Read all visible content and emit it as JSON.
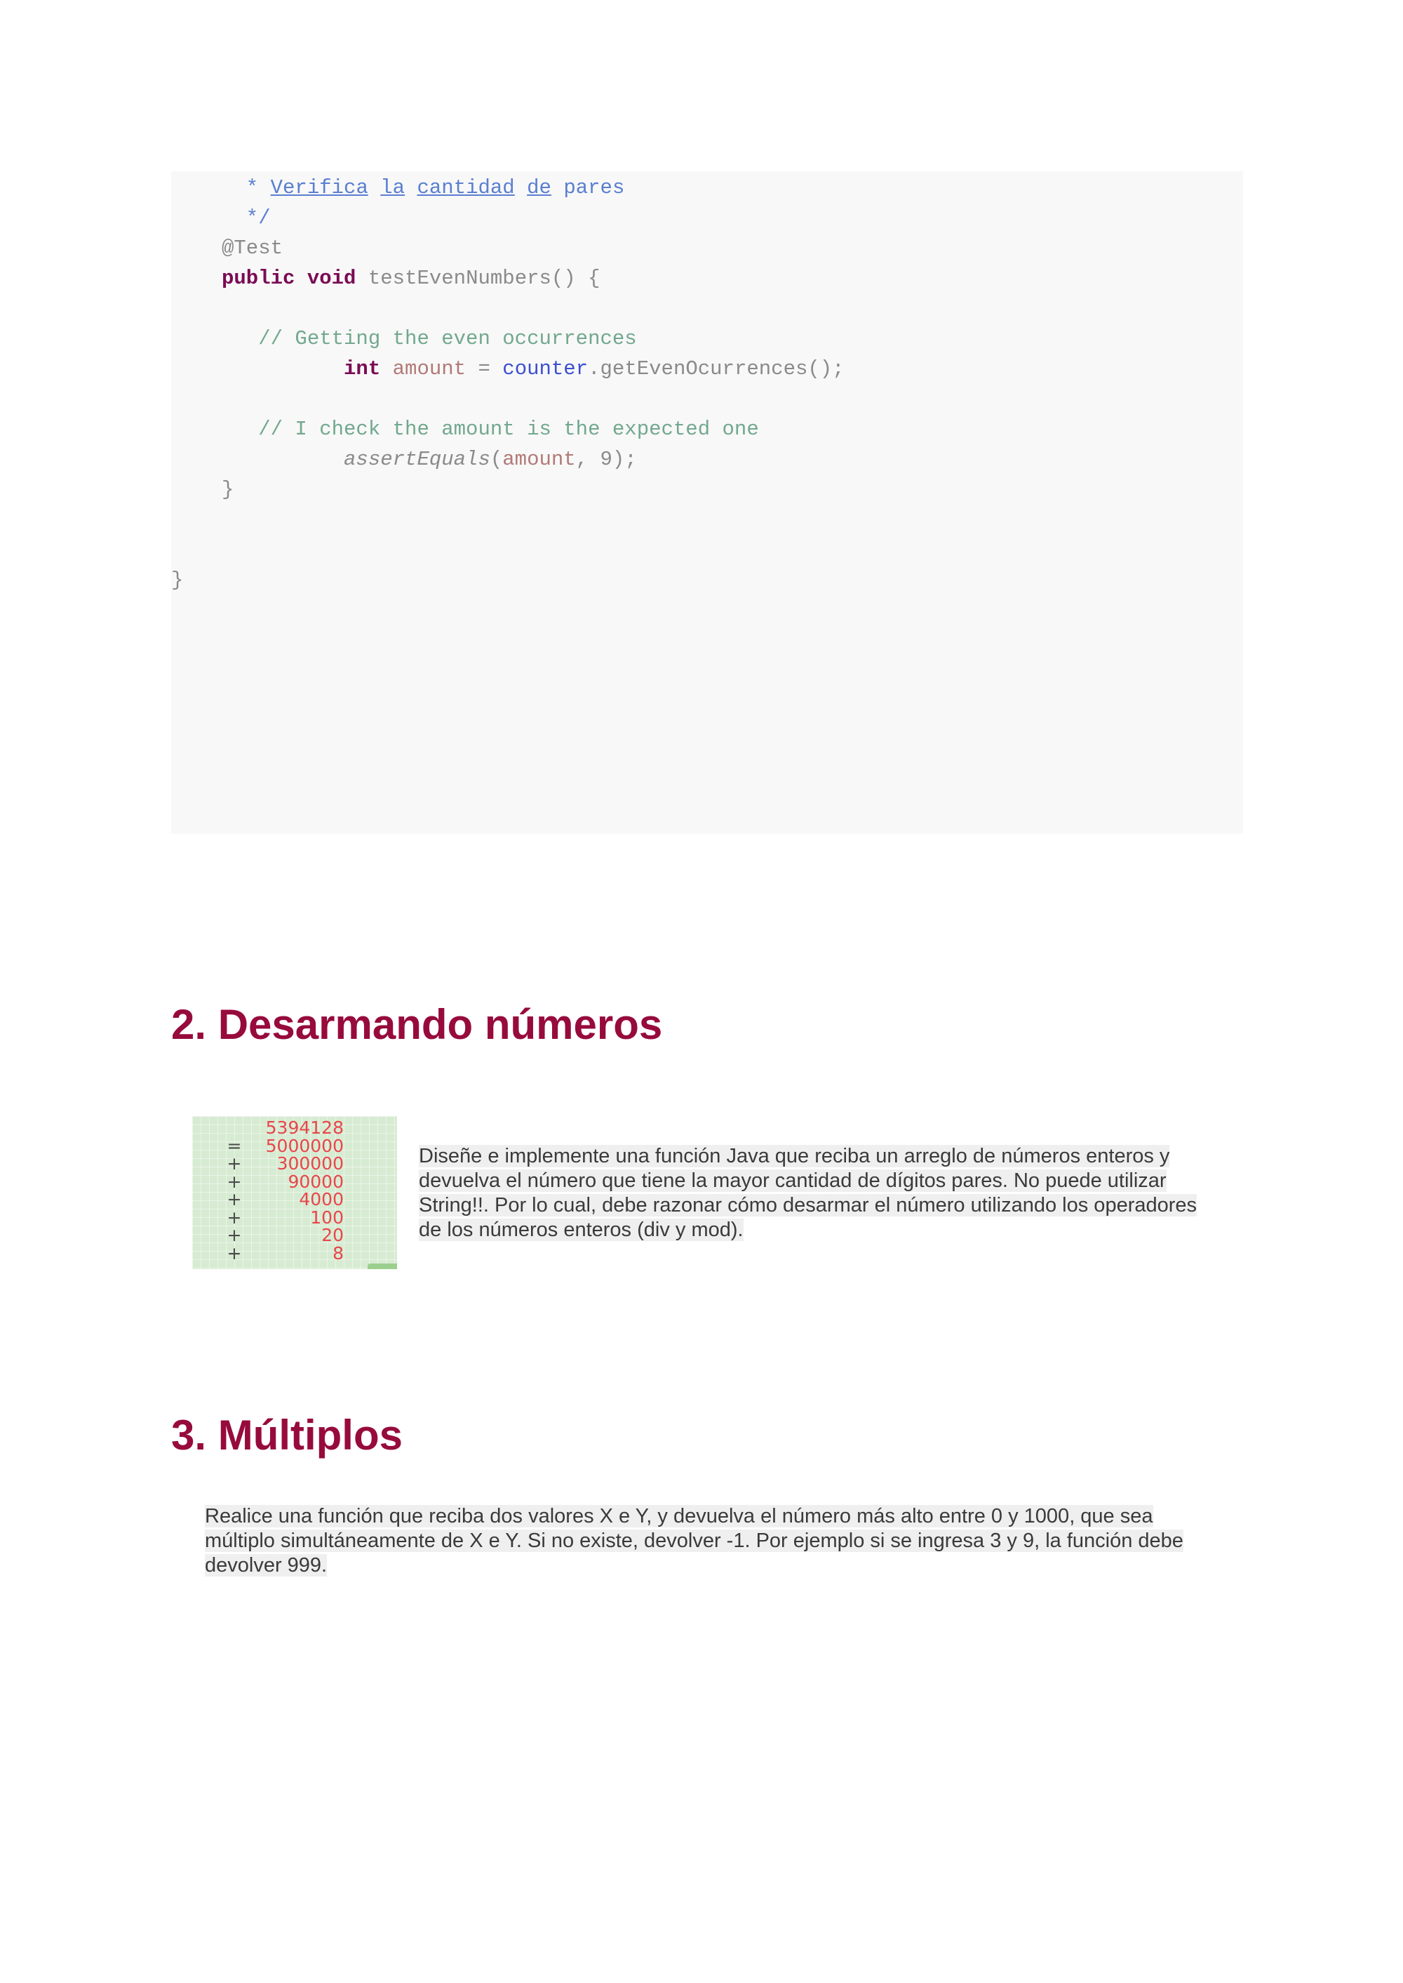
{
  "code": {
    "lines": [
      [
        {
          "t": "  * ",
          "c": "c-doc"
        },
        {
          "t": "Verifica",
          "c": "c-doc-u"
        },
        {
          "t": " ",
          "c": "c-doc"
        },
        {
          "t": "la",
          "c": "c-doc-u"
        },
        {
          "t": " ",
          "c": "c-doc"
        },
        {
          "t": "cantidad",
          "c": "c-doc-u"
        },
        {
          "t": " ",
          "c": "c-doc"
        },
        {
          "t": "de",
          "c": "c-doc-u"
        },
        {
          "t": " pares",
          "c": "c-doc"
        }
      ],
      [
        {
          "t": "  */",
          "c": "c-doc"
        }
      ],
      [
        {
          "t": "@Test",
          "c": "c-plain"
        }
      ],
      [
        {
          "t": "public",
          "c": "c-kw"
        },
        {
          "t": " ",
          "c": "c-plain"
        },
        {
          "t": "void",
          "c": "c-kw"
        },
        {
          "t": " testEvenNumbers() {",
          "c": "c-plain"
        }
      ],
      [],
      [
        {
          "t": "   // Getting the even occurrences",
          "c": "c-cmt"
        }
      ],
      [
        {
          "t": "          ",
          "c": "c-plain"
        },
        {
          "t": "int",
          "c": "c-kw"
        },
        {
          "t": " ",
          "c": "c-plain"
        },
        {
          "t": "amount",
          "c": "c-var"
        },
        {
          "t": " = ",
          "c": "c-plain"
        },
        {
          "t": "counter",
          "c": "c-field"
        },
        {
          "t": ".getEvenOcurrences();",
          "c": "c-plain"
        }
      ],
      [],
      [
        {
          "t": "   // I check the amount is the expected one",
          "c": "c-cmt"
        }
      ],
      [
        {
          "t": "          ",
          "c": "c-plain"
        },
        {
          "t": "assertEquals",
          "c": "c-italic"
        },
        {
          "t": "(",
          "c": "c-plain"
        },
        {
          "t": "amount",
          "c": "c-var"
        },
        {
          "t": ", 9);",
          "c": "c-plain"
        }
      ],
      [
        {
          "t": "}",
          "c": "c-plain"
        }
      ],
      [],
      [],
      [
        {
          "t": "}",
          "c": "c-plain"
        }
      ]
    ]
  },
  "section2": {
    "title": "2. Desarmando números",
    "figure": {
      "rows": [
        {
          "op": "",
          "num": "5394128"
        },
        {
          "op": "=",
          "num": "5000000"
        },
        {
          "op": "+",
          "num": "300000"
        },
        {
          "op": "+",
          "num": "90000"
        },
        {
          "op": "+",
          "num": "4000"
        },
        {
          "op": "+",
          "num": "100"
        },
        {
          "op": "+",
          "num": "20"
        },
        {
          "op": "+",
          "num": "8"
        }
      ]
    },
    "lines": [
      "Diseñe e implemente una función Java que reciba un arreglo de números enteros y",
      "devuelva el número que tiene la mayor cantidad de dígitos pares. No puede utilizar",
      "String!!. Por lo cual, debe razonar cómo desarmar el número utilizando los operadores",
      "de los números enteros (div y mod)."
    ]
  },
  "section3": {
    "title": "3. Múltiplos",
    "lines": [
      "Realice una función que reciba dos valores X e Y, y devuelva el número más alto entre 0 y 1000, que sea",
      "múltiplo simultáneamente de X e Y. Si no existe, devolver -1. Por ejemplo si se ingresa 3 y 9, la función debe",
      "devolver 999."
    ]
  }
}
